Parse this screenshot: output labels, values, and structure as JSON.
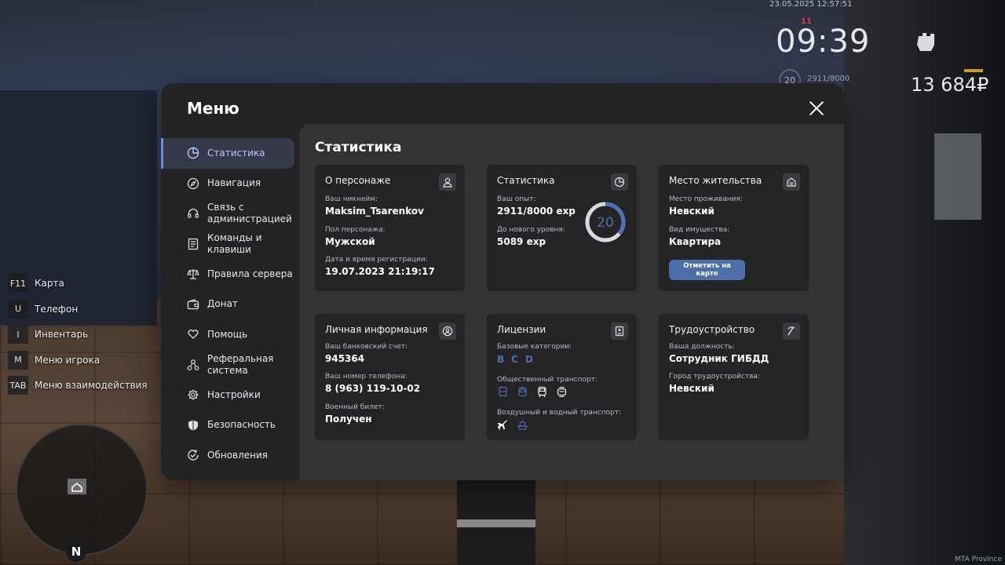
{
  "hud": {
    "datetime": "23.05.2025 12:57:51",
    "dot": "11",
    "time": "09:39",
    "level": "20",
    "exp": "2911/8000",
    "money": "13 684₽"
  },
  "hotkeys": [
    {
      "key": "F11",
      "label": "Карта"
    },
    {
      "key": "U",
      "label": "Телефон"
    },
    {
      "key": "I",
      "label": "Инвентарь"
    },
    {
      "key": "M",
      "label": "Меню игрока"
    },
    {
      "key": "TAB",
      "label": "Меню взаимодействия"
    }
  ],
  "minimap": {
    "north": "N"
  },
  "watermark": "MTA Province #",
  "menu": {
    "title": "Меню",
    "sidebar": [
      {
        "label": "Статистика",
        "icon": "pie-chart-icon"
      },
      {
        "label": "Навигация",
        "icon": "compass-icon"
      },
      {
        "label": "Связь с администрацией",
        "icon": "headset-icon"
      },
      {
        "label": "Команды и клавиши",
        "icon": "document-icon"
      },
      {
        "label": "Правила сервера",
        "icon": "scales-icon"
      },
      {
        "label": "Донат",
        "icon": "wallet-icon"
      },
      {
        "label": "Помощь",
        "icon": "heart-hands-icon"
      },
      {
        "label": "Реферальная система",
        "icon": "people-network-icon"
      },
      {
        "label": "Настройки",
        "icon": "gear-icon"
      },
      {
        "label": "Безопасность",
        "icon": "shield-icon"
      },
      {
        "label": "Обновления",
        "icon": "refresh-check-icon"
      }
    ],
    "content_title": "Статистика",
    "character": {
      "title": "О персонаже",
      "nick_label": "Ваш никнейм:",
      "nick": "Maksim_Tsarenkov",
      "gender_label": "Пол персонажа:",
      "gender": "Мужской",
      "reg_label": "Дата и время регистрации:",
      "reg": "19.07.2023 21:19:17"
    },
    "stats": {
      "title": "Статистика",
      "exp_label": "Ваш опыт:",
      "exp": "2911/8000 exp",
      "next_label": "До нового уровня:",
      "next": "5089 exp",
      "level": "20",
      "progress": 0.36
    },
    "residence": {
      "title": "Место жительства",
      "place_label": "Место проживания:",
      "place": "Невский",
      "property_label": "Вид имущества:",
      "property": "Квартира",
      "map_button": "Отметить на карте"
    },
    "personal": {
      "title": "Личная информация",
      "bank_label": "Ваш банковский счет:",
      "bank": "945364",
      "phone_label": "Ваш номер телефона:",
      "phone": "8 (963) 119-10-02",
      "military_label": "Военный билет:",
      "military": "Получен"
    },
    "licenses": {
      "title": "Лицензии",
      "base_label": "Базовые категории:",
      "categories": [
        "B",
        "C",
        "D"
      ],
      "public_label": "Общественный транспорт:",
      "air_label": "Воздушный и водный транспорт:"
    },
    "employment": {
      "title": "Трудоустройство",
      "position_label": "Ваша должность:",
      "position": "Сотрудник ГИБДД",
      "city_label": "Город трудоустройства:",
      "city": "Невский"
    }
  },
  "colors": {
    "accent": "#6a8be0",
    "button": "#4d6ea8",
    "license": "#4f6fae"
  }
}
